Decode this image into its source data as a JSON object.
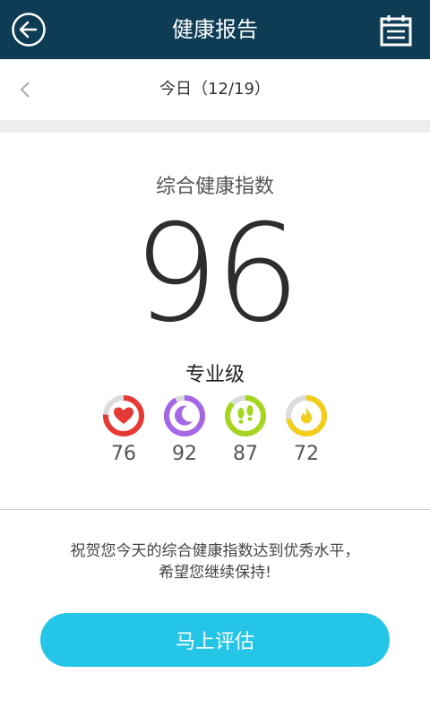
{
  "header": {
    "title": "健康报告",
    "back_icon": "back-arrow-icon",
    "calendar_icon": "calendar-icon"
  },
  "datebar": {
    "label": "今日（12/19）"
  },
  "summary": {
    "title": "综合健康指数",
    "score": "96",
    "level": "专业级"
  },
  "metrics": [
    {
      "name": "heart",
      "icon": "heart-icon",
      "value": "76",
      "progress": 0.76,
      "color": "#e53935"
    },
    {
      "name": "sleep",
      "icon": "moon-icon",
      "value": "92",
      "progress": 0.92,
      "color": "#a567e8"
    },
    {
      "name": "steps",
      "icon": "footprints-icon",
      "value": "87",
      "progress": 0.87,
      "color": "#a6d51f"
    },
    {
      "name": "calories",
      "icon": "flame-icon",
      "value": "72",
      "progress": 0.72,
      "color": "#f2cd1c"
    }
  ],
  "message": {
    "line1": "祝贺您今天的综合健康指数达到优秀水平，",
    "line2": "希望您继续保持!"
  },
  "cta": {
    "label": "马上评估"
  },
  "colors": {
    "header_bg": "#0f3c55",
    "accent": "#24c5e6"
  }
}
